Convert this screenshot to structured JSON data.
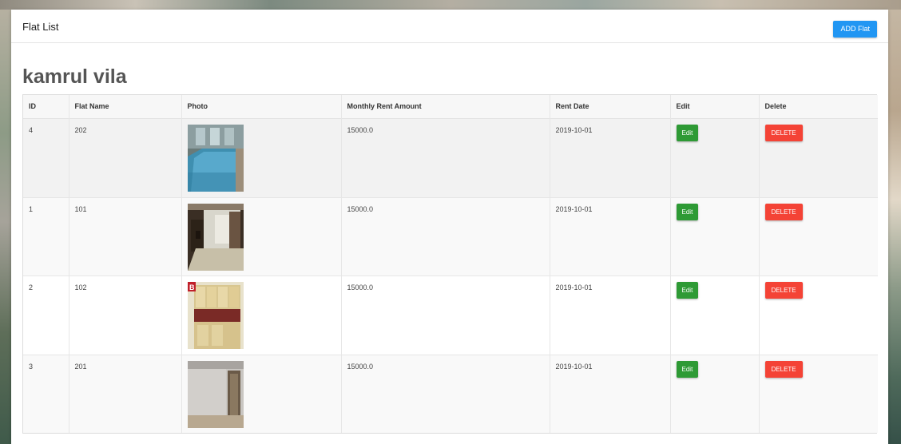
{
  "panel": {
    "title": "Flat List",
    "add_button": "ADD Flat"
  },
  "building_name": "kamrul vila",
  "table": {
    "headers": [
      "ID",
      "Flat Name",
      "Photo",
      "Monthly Rent Amount",
      "Rent Date",
      "Edit",
      "Delete"
    ],
    "rows": [
      {
        "id": "4",
        "flat_name": "202",
        "photo": "pool-photo",
        "rent": "15000.0",
        "rent_date": "2019-10-01",
        "edit": "Edit",
        "delete": "DELETE"
      },
      {
        "id": "1",
        "flat_name": "101",
        "photo": "room-photo",
        "rent": "15000.0",
        "rent_date": "2019-10-01",
        "edit": "Edit",
        "delete": "DELETE"
      },
      {
        "id": "2",
        "flat_name": "102",
        "photo": "kitchen-photo",
        "rent": "15000.0",
        "rent_date": "2019-10-01",
        "edit": "Edit",
        "delete": "DELETE"
      },
      {
        "id": "3",
        "flat_name": "201",
        "photo": "bedroom-photo",
        "rent": "15000.0",
        "rent_date": "2019-10-01",
        "edit": "Edit",
        "delete": "DELETE"
      }
    ]
  },
  "colors": {
    "add_button": "#2196f3",
    "edit_button": "#2e9a35",
    "delete_button": "#f44336",
    "heading": "#555555"
  }
}
